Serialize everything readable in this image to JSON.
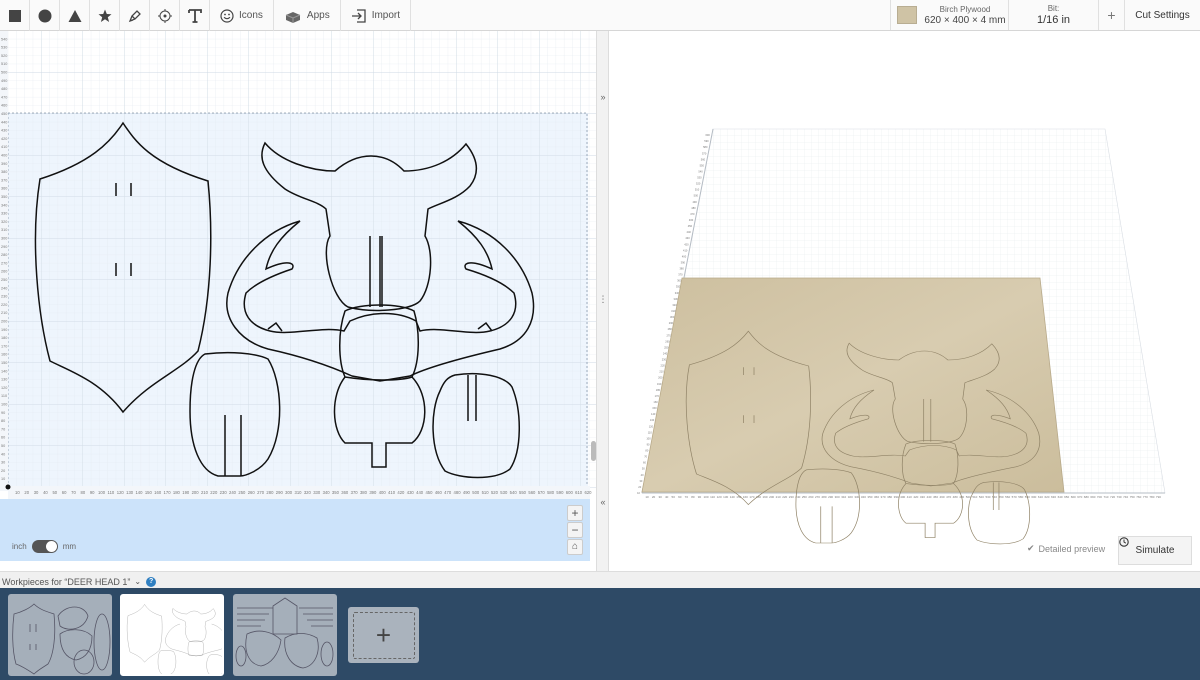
{
  "toolbar": {
    "tools": [
      "square-tool",
      "circle-tool",
      "triangle-tool",
      "star-tool",
      "pen-tool",
      "target-tool",
      "text-tool"
    ],
    "icons_label": "Icons",
    "apps_label": "Apps",
    "import_label": "Import"
  },
  "material": {
    "name": "Birch Plywood",
    "dimensions": "620 × 400 × 4 mm",
    "color": "#cfc3a5"
  },
  "bit": {
    "label": "Bit:",
    "value": "1/16 in"
  },
  "cut_settings_label": "Cut Settings",
  "units": {
    "left": "inch",
    "right": "mm",
    "selected": "mm"
  },
  "zoom": {
    "in": "+",
    "out": "−"
  },
  "canvas": {
    "x_ticks": [
      "10",
      "20",
      "30",
      "40",
      "50",
      "60",
      "70",
      "80",
      "90",
      "100",
      "110",
      "120",
      "130",
      "140",
      "150",
      "160",
      "170",
      "180",
      "190",
      "200",
      "210",
      "220",
      "230",
      "240",
      "250",
      "260",
      "270",
      "280",
      "290",
      "300",
      "310",
      "320",
      "330",
      "340",
      "350",
      "360",
      "370",
      "380",
      "390",
      "400",
      "410",
      "420",
      "430",
      "440",
      "450",
      "460",
      "470",
      "480",
      "490",
      "500",
      "510",
      "520",
      "530",
      "540",
      "550",
      "560",
      "570",
      "580",
      "590",
      "600",
      "610",
      "620"
    ],
    "y_ticks": [
      "10",
      "20",
      "30",
      "40",
      "50",
      "60",
      "70",
      "80",
      "90",
      "100",
      "110",
      "120",
      "130",
      "140",
      "150",
      "160",
      "170",
      "180",
      "190",
      "200",
      "210",
      "220",
      "230",
      "240",
      "250",
      "260",
      "270",
      "280",
      "290",
      "300",
      "310",
      "320",
      "330",
      "340",
      "350",
      "360",
      "370",
      "380",
      "390",
      "400",
      "410",
      "420",
      "430",
      "440",
      "450",
      "460",
      "470",
      "480",
      "490",
      "500",
      "510",
      "520",
      "530",
      "540",
      "550",
      "560",
      "570",
      "580",
      "590",
      "600",
      "610",
      "620"
    ]
  },
  "preview": {
    "detailed_label": "Detailed preview",
    "simulate_label": "Simulate",
    "x_ticks": [
      "10",
      "20",
      "30",
      "40",
      "50",
      "60",
      "70",
      "80",
      "90",
      "100",
      "110",
      "120",
      "130",
      "140",
      "150",
      "160",
      "170",
      "180",
      "190",
      "200",
      "210",
      "220",
      "230",
      "240",
      "250",
      "260",
      "270",
      "280",
      "290",
      "300",
      "310",
      "320",
      "330",
      "340",
      "350",
      "360",
      "370",
      "380",
      "390",
      "400",
      "410",
      "420",
      "430",
      "440",
      "450",
      "460",
      "470",
      "480",
      "490",
      "500",
      "510",
      "520",
      "530",
      "540",
      "550",
      "560",
      "570",
      "580",
      "590",
      "600",
      "610",
      "620",
      "630",
      "640",
      "650",
      "660",
      "670",
      "680",
      "690",
      "700",
      "710",
      "720",
      "730",
      "740",
      "750",
      "760",
      "770",
      "780",
      "790"
    ]
  },
  "workpieces": {
    "title": "Workpieces for “DEER HEAD 1”",
    "help": "?",
    "add_symbol": "+"
  }
}
